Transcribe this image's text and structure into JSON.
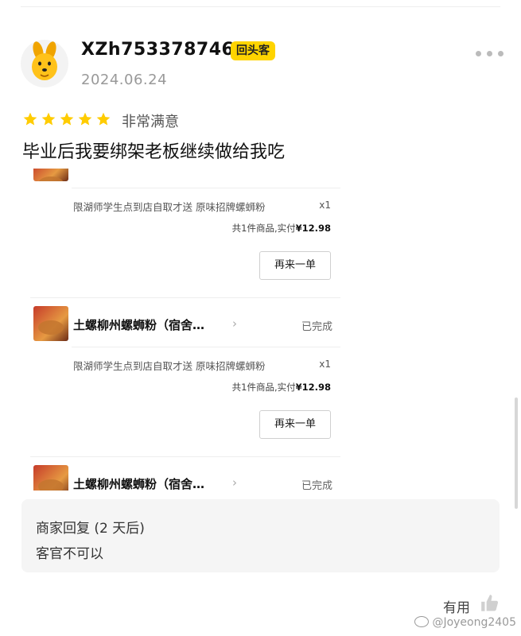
{
  "review": {
    "username": "XZh753378746",
    "badge": "回头客",
    "date": "2024.06.24",
    "stars": 5,
    "rating_text": "非常满意",
    "text": "毕业后我要绑架老板继续做给我吃"
  },
  "orders": [
    {
      "store_name": "",
      "status": "",
      "item_desc": "限湖师学生点到店自取才送 原味招牌螺蛳粉",
      "qty": "x1",
      "summary_prefix": "共1件商品,实付",
      "summary_price": "¥12.98",
      "reorder_label": "再来一单"
    },
    {
      "store_name": "土螺柳州螺蛳粉（宿舍…",
      "status": "已完成",
      "item_desc": "限湖师学生点到店自取才送 原味招牌螺蛳粉",
      "qty": "x1",
      "summary_prefix": "共1件商品,实付",
      "summary_price": "¥12.98",
      "reorder_label": "再来一单"
    },
    {
      "store_name": "土螺柳州螺蛳粉（宿舍…",
      "status": "已完成"
    }
  ],
  "merchant_reply": {
    "title": "商家回复 (2 天后)",
    "text": "客官不可以"
  },
  "footer": {
    "useful_label": "有用",
    "watermark": "@Joyeong2405"
  },
  "colors": {
    "star": "#ffcc00",
    "badge": "#ffd400",
    "avatar_mascot": "#ffb800"
  }
}
